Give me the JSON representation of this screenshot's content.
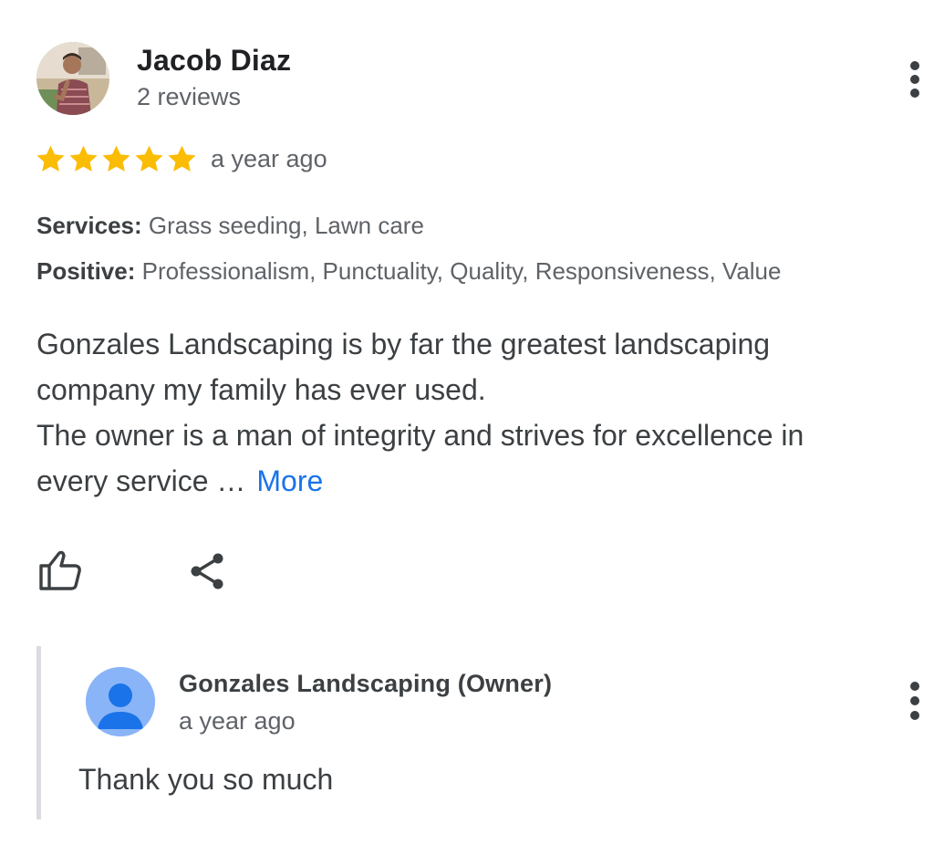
{
  "review": {
    "reviewer_name": "Jacob Diaz",
    "reviewer_meta": "2 reviews",
    "rating": 5,
    "rating_max": 5,
    "time": "a year ago",
    "services_label": "Services:",
    "services_value": " Grass seeding, Lawn care",
    "positive_label": "Positive:",
    "positive_value": " Professionalism, Punctuality, Quality, Responsiveness, Value",
    "body_lines": [
      "Gonzales Landscaping is by far the greatest landscaping",
      "company my family has ever used.",
      "The owner is a man of integrity and strives for excellence in",
      "every service …"
    ],
    "more_label": "More",
    "icons": {
      "menu": "more-vert-icon",
      "star": "star-icon",
      "like": "thumb-up-icon",
      "share": "share-icon"
    }
  },
  "reply": {
    "owner_name": "Gonzales Landscaping (Owner)",
    "time": "a year ago",
    "text": "Thank you so much",
    "icons": {
      "avatar": "person-icon",
      "menu": "more-vert-icon"
    }
  },
  "colors": {
    "star": "#fbbc04",
    "link": "#1a73e8",
    "owner_avatar_bg": "#8ab4f8",
    "owner_avatar_fg": "#1a73e8",
    "reply_rule": "#dadce0"
  }
}
